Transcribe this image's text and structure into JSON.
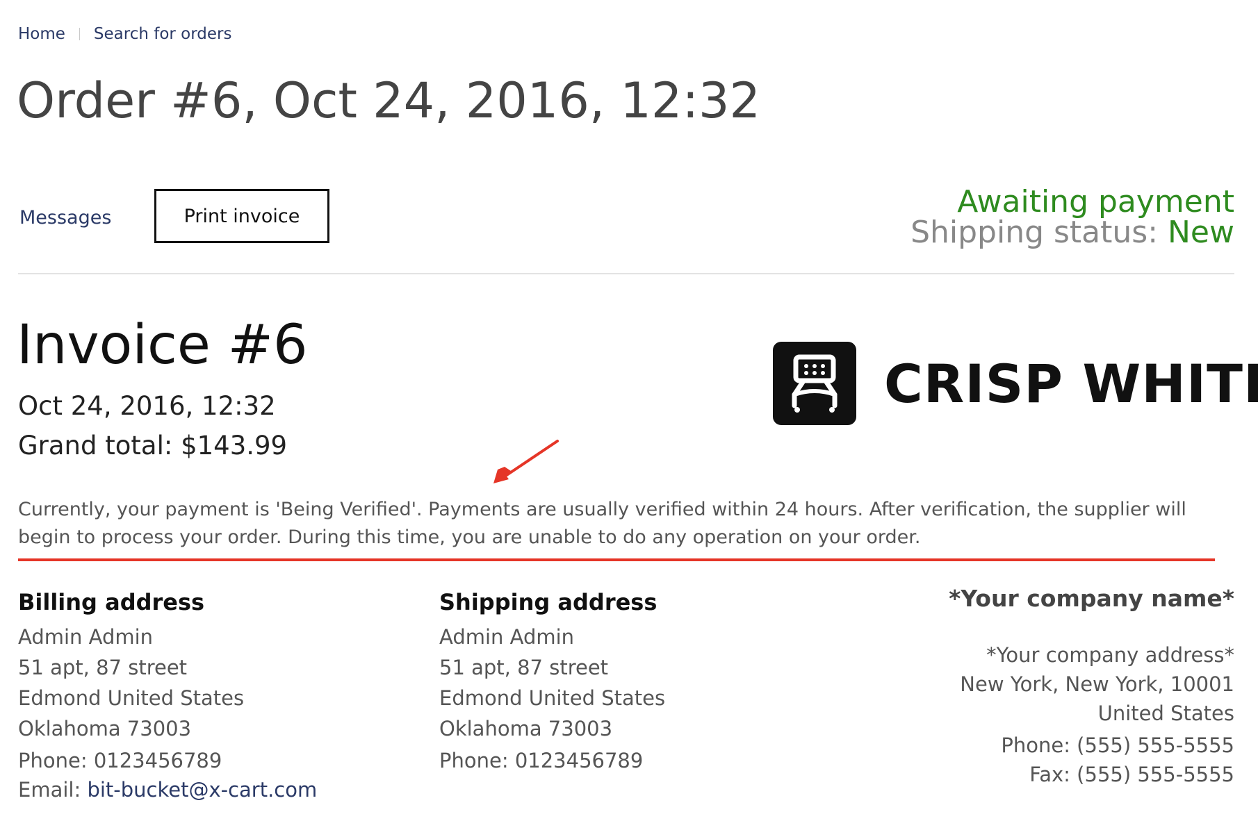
{
  "breadcrumb": {
    "home": "Home",
    "search": "Search for orders"
  },
  "page_title": "Order #6, Oct 24, 2016, 12:32",
  "actions": {
    "messages": "Messages",
    "print_invoice": "Print invoice"
  },
  "status": {
    "payment": "Awaiting payment",
    "shipping_label": "Shipping status:",
    "shipping_value": "New",
    "color": "#2e8b1f"
  },
  "invoice": {
    "title": "Invoice #6",
    "date": "Oct 24, 2016, 12:32",
    "grand_total": "Grand total: $143.99"
  },
  "logo": {
    "text": "CRISP WHITE",
    "icon": "cart-logo-icon"
  },
  "notice": "Currently, your payment is 'Being Verified'. Payments are usually verified within 24 hours. After verification, the supplier will begin to process your order. During this time, you are unable to do any operation on your order.",
  "annotation_color": "#e53527",
  "billing": {
    "heading": "Billing address",
    "name": "Admin  Admin",
    "street": "51 apt, 87 street",
    "city_country": "Edmond  United States",
    "state_zip": "Oklahoma  73003",
    "phone": "Phone: 0123456789",
    "email_label": "Email: ",
    "email": "bit-bucket@x-cart.com"
  },
  "shipping": {
    "heading": "Shipping address",
    "name": "Admin  Admin",
    "street": "51 apt, 87 street",
    "city_country": "Edmond  United States",
    "state_zip": "Oklahoma  73003",
    "phone": "Phone: 0123456789"
  },
  "company": {
    "name": "*Your company name*",
    "address": "*Your company address*",
    "city": "New York, New York, 10001",
    "country": "United States",
    "phone": "Phone: (555) 555-5555",
    "fax": "Fax: (555) 555-5555"
  }
}
